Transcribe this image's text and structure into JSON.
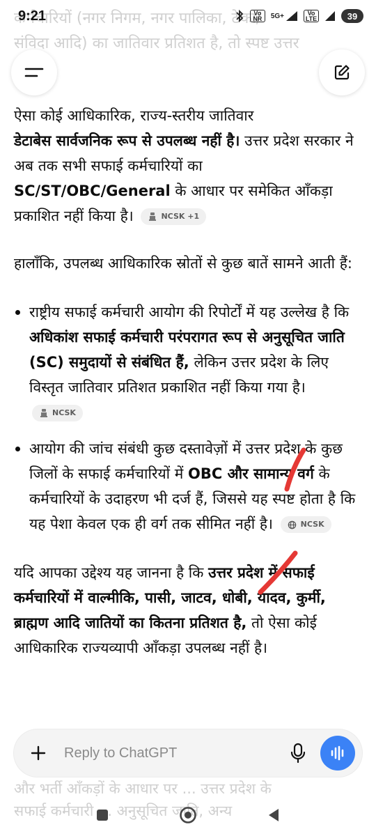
{
  "status_bar": {
    "time": "9:21",
    "network_5g": "5G+",
    "volte_1": "Vo NR",
    "volte_2": "Vo LTE",
    "battery": "39"
  },
  "background_text": {
    "top_line_1": "कर्मचारियों (नगर निगम, नगर पालिका, ठेका/",
    "top_line_2": "संविदा आदि) का जातिवार प्रतिशत है, तो स्पष्ट उत्तर",
    "bottom_line_1": "और भर्ती आँकड़ों के आधार पर ... उत्तर प्रदेश के",
    "bottom_line_2": "सफाई कर्मचारी ... अनुसूचित जाति, अन्य"
  },
  "top_bar": {
    "menu_icon": "menu-icon",
    "compose_icon": "edit-icon"
  },
  "message": {
    "p1": {
      "t1": "ऐसा कोई आधिकारिक, राज्य-स्तरीय जातिवार",
      "b1": "डेटाबेस सार्वजनिक रूप से उपलब्ध नहीं है।",
      "t2": " उत्तर प्रदेश सरकार ने अब तक सभी सफाई कर्मचारियों का ",
      "b2": "SC/ST/OBC/General",
      "t3": " के आधार पर समेकित आँकड़ा प्रकाशित नहीं किया है।",
      "chip": "NCSK +1"
    },
    "p2": "हालाँकि, उपलब्ध आधिकारिक स्रोतों से कुछ बातें सामने आती हैं:",
    "bullet1": {
      "t1": "राष्ट्रीय सफाई कर्मचारी आयोग की रिपोर्टों में यह उल्लेख है कि ",
      "b1": "अधिकांश सफाई कर्मचारी परंपरागत रूप से अनुसूचित जाति (SC) समुदायों से संबंधित हैं,",
      "t2": " लेकिन उत्तर प्रदेश के लिए विस्तृत जातिवार प्रतिशत प्रकाशित नहीं किया गया है।",
      "chip": "NCSK"
    },
    "bullet2": {
      "t1": "आयोग की जांच संबंधी कुछ दस्तावेज़ों में उत्तर प्रदेश के कुछ जिलों के सफाई कर्मचारियों में ",
      "b1": "OBC और सामान्य वर्ग",
      "t2": " के कर्मचारियों के उदाहरण भी दर्ज हैं, जिससे यह स्पष्ट होता है कि यह पेशा केवल एक ही वर्ग तक सीमित नहीं है।",
      "chip": "NCSK"
    },
    "p3": {
      "t1": "यदि आपका उद्देश्य यह जानना है कि ",
      "b1": "उत्तर प्रदेश में सफाई कर्मचारियों में वाल्मीकि, पासी, जाटव, धोबी, यादव, कुर्मी, ब्राह्मण आदि जातियों का कितना प्रतिशत है,",
      "t2": " तो ऐसा कोई आधिकारिक राज्यव्यापी आँकड़ा उपलब्ध नहीं है।"
    }
  },
  "composer": {
    "placeholder": "Reply to ChatGPT"
  },
  "colors": {
    "accent_blue": "#3b82f6",
    "red_annotation": "#e53935",
    "chip_bg": "#f0f0f0"
  }
}
